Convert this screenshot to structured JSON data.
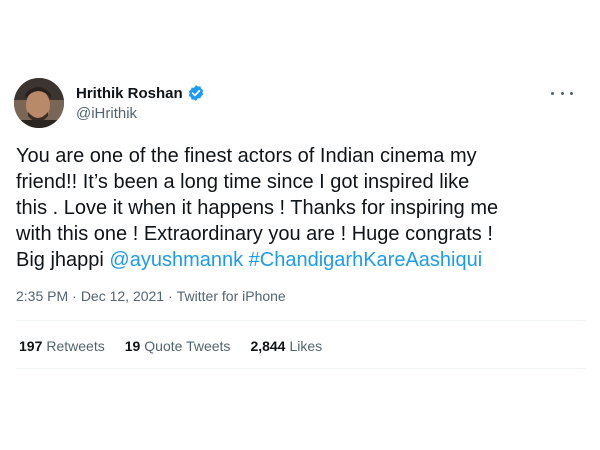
{
  "author": {
    "display_name": "Hrithik Roshan",
    "handle": "@iHrithik",
    "verified": true,
    "avatar_icon": "profile-photo-icon",
    "verified_color": "#1d9bf0"
  },
  "tweet": {
    "text_line_1": "You are one of the finest actors of Indian cinema my",
    "text_line_2": "friend!! It’s been a long time since I got inspired like",
    "text_line_3": "this . Love it when it happens ! Thanks for inspiring me",
    "text_line_4": "with this one ! Extraordinary you are ! Huge congrats !",
    "text_line_5_prefix": "Big jhappi ",
    "mention": "@ayushmannk",
    "hashtag": "#ChandigarhKareAashiqui",
    "link_color": "#1d9bf0"
  },
  "meta": {
    "time": "2:35 PM",
    "separator": "·",
    "date": "Dec 12, 2021",
    "source": "Twitter for iPhone"
  },
  "stats": {
    "retweets_count": "197",
    "retweets_label": "Retweets",
    "quotes_count": "19",
    "quotes_label": "Quote Tweets",
    "likes_count": "2,844",
    "likes_label": "Likes"
  },
  "menu": {
    "more_icon": "more-horizontal-icon"
  }
}
